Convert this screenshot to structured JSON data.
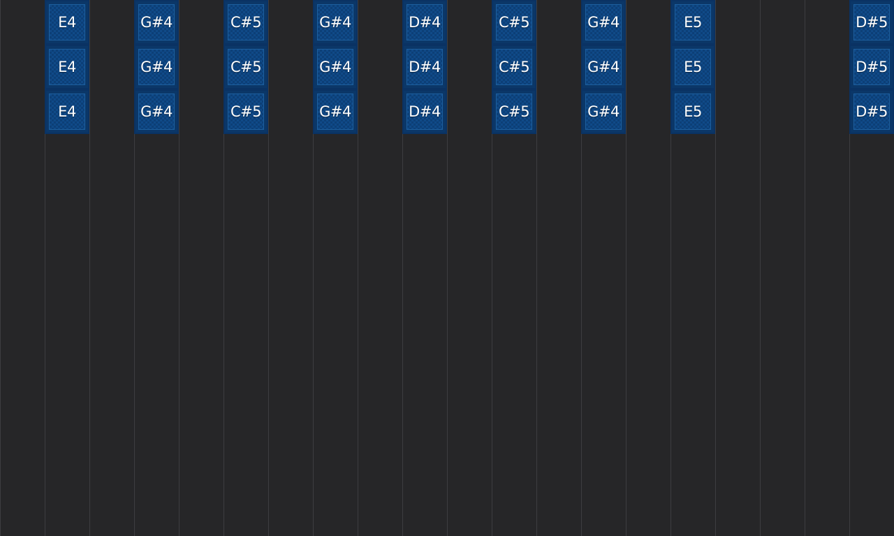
{
  "colors": {
    "background": "#262628",
    "grid_line": "#3d3d40",
    "note_fill": "#104a88",
    "note_border": "#0a3263",
    "note_text": "#ffffff"
  },
  "columns": [
    {
      "notes": []
    },
    {
      "notes": [
        "E4",
        "E4",
        "E4"
      ]
    },
    {
      "notes": []
    },
    {
      "notes": [
        "G#4",
        "G#4",
        "G#4"
      ]
    },
    {
      "notes": []
    },
    {
      "notes": [
        "C#5",
        "C#5",
        "C#5"
      ]
    },
    {
      "notes": []
    },
    {
      "notes": [
        "G#4",
        "G#4",
        "G#4"
      ]
    },
    {
      "notes": []
    },
    {
      "notes": [
        "D#4",
        "D#4",
        "D#4"
      ]
    },
    {
      "notes": []
    },
    {
      "notes": [
        "C#5",
        "C#5",
        "C#5"
      ]
    },
    {
      "notes": []
    },
    {
      "notes": [
        "G#4",
        "G#4",
        "G#4"
      ]
    },
    {
      "notes": []
    },
    {
      "notes": [
        "E5",
        "E5",
        "E5"
      ]
    },
    {
      "notes": []
    },
    {
      "notes": []
    },
    {
      "notes": []
    },
    {
      "notes": [
        "D#5",
        "D#5",
        "D#5"
      ]
    }
  ]
}
